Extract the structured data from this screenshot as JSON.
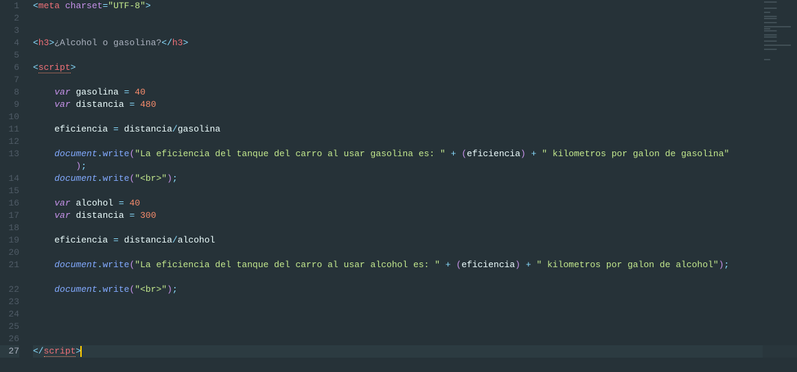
{
  "lines": [
    {
      "num": 1,
      "indent": 0,
      "tokens": [
        [
          "punct",
          "<"
        ],
        [
          "tag",
          "meta"
        ],
        [
          "text",
          " "
        ],
        [
          "attr",
          "charset"
        ],
        [
          "op",
          "="
        ],
        [
          "string",
          "\"UTF-8\""
        ],
        [
          "punct",
          ">"
        ]
      ]
    },
    {
      "num": 2,
      "indent": 0,
      "tokens": []
    },
    {
      "num": 3,
      "indent": 0,
      "tokens": []
    },
    {
      "num": 4,
      "indent": 0,
      "tokens": [
        [
          "punct",
          "<"
        ],
        [
          "tag",
          "h3"
        ],
        [
          "punct",
          ">"
        ],
        [
          "text",
          "¿Alcohol o gasolina?"
        ],
        [
          "punct",
          "</"
        ],
        [
          "tag",
          "h3"
        ],
        [
          "punct",
          ">"
        ]
      ]
    },
    {
      "num": 5,
      "indent": 0,
      "tokens": []
    },
    {
      "num": 6,
      "indent": 0,
      "tokens": [
        [
          "punct",
          "<"
        ],
        [
          "tag-sq",
          "script"
        ],
        [
          "punct",
          ">"
        ]
      ]
    },
    {
      "num": 7,
      "indent": 1,
      "tokens": []
    },
    {
      "num": 8,
      "indent": 1,
      "tokens": [
        [
          "keyword",
          "var"
        ],
        [
          "text",
          " "
        ],
        [
          "var",
          "gasolina"
        ],
        [
          "text",
          " "
        ],
        [
          "op",
          "="
        ],
        [
          "text",
          " "
        ],
        [
          "num",
          "40"
        ]
      ]
    },
    {
      "num": 9,
      "indent": 1,
      "tokens": [
        [
          "keyword",
          "var"
        ],
        [
          "text",
          " "
        ],
        [
          "var",
          "distancia"
        ],
        [
          "text",
          " "
        ],
        [
          "op",
          "="
        ],
        [
          "text",
          " "
        ],
        [
          "num",
          "480"
        ]
      ]
    },
    {
      "num": 10,
      "indent": 1,
      "tokens": []
    },
    {
      "num": 11,
      "indent": 1,
      "tokens": [
        [
          "var",
          "eficiencia"
        ],
        [
          "text",
          " "
        ],
        [
          "op",
          "="
        ],
        [
          "text",
          " "
        ],
        [
          "var",
          "distancia"
        ],
        [
          "op",
          "/"
        ],
        [
          "var",
          "gasolina"
        ]
      ]
    },
    {
      "num": 12,
      "indent": 1,
      "tokens": []
    },
    {
      "num": 13,
      "indent": 1,
      "wrap": true,
      "tokens": [
        [
          "obj",
          "document"
        ],
        [
          "op",
          "."
        ],
        [
          "func",
          "write"
        ],
        [
          "paren",
          "("
        ],
        [
          "string",
          "\"La eficiencia del tanque del carro al usar gasolina es: \""
        ],
        [
          "text",
          " "
        ],
        [
          "op",
          "+"
        ],
        [
          "text",
          " "
        ],
        [
          "paren",
          "("
        ],
        [
          "var",
          "eficiencia"
        ],
        [
          "paren",
          ")"
        ],
        [
          "text",
          " "
        ],
        [
          "op",
          "+"
        ],
        [
          "text",
          " "
        ],
        [
          "string",
          "\" kilometros por galon de gasolina\""
        ]
      ]
    },
    {
      "num": "13b",
      "indent": 2,
      "isWrapCont": true,
      "tokens": [
        [
          "paren",
          ")"
        ],
        [
          "punct",
          ";"
        ]
      ]
    },
    {
      "num": 14,
      "indent": 1,
      "tokens": [
        [
          "obj",
          "document"
        ],
        [
          "op",
          "."
        ],
        [
          "func",
          "write"
        ],
        [
          "paren",
          "("
        ],
        [
          "string",
          "\"<br>\""
        ],
        [
          "paren",
          ")"
        ],
        [
          "punct",
          ";"
        ]
      ]
    },
    {
      "num": 15,
      "indent": 1,
      "tokens": []
    },
    {
      "num": 16,
      "indent": 1,
      "tokens": [
        [
          "keyword",
          "var"
        ],
        [
          "text",
          " "
        ],
        [
          "var",
          "alcohol"
        ],
        [
          "text",
          " "
        ],
        [
          "op",
          "="
        ],
        [
          "text",
          " "
        ],
        [
          "num",
          "40"
        ]
      ]
    },
    {
      "num": 17,
      "indent": 1,
      "tokens": [
        [
          "keyword",
          "var"
        ],
        [
          "text",
          " "
        ],
        [
          "var",
          "distancia"
        ],
        [
          "text",
          " "
        ],
        [
          "op",
          "="
        ],
        [
          "text",
          " "
        ],
        [
          "num",
          "300"
        ]
      ]
    },
    {
      "num": 18,
      "indent": 1,
      "tokens": []
    },
    {
      "num": 19,
      "indent": 1,
      "tokens": [
        [
          "var",
          "eficiencia"
        ],
        [
          "text",
          " "
        ],
        [
          "op",
          "="
        ],
        [
          "text",
          " "
        ],
        [
          "var",
          "distancia"
        ],
        [
          "op",
          "/"
        ],
        [
          "var",
          "alcohol"
        ]
      ]
    },
    {
      "num": 20,
      "indent": 1,
      "tokens": []
    },
    {
      "num": 21,
      "indent": 1,
      "tokens": [
        [
          "obj",
          "document"
        ],
        [
          "op",
          "."
        ],
        [
          "func",
          "write"
        ],
        [
          "paren",
          "("
        ],
        [
          "string",
          "\"La eficiencia del tanque del carro al usar alcohol es: \""
        ],
        [
          "text",
          " "
        ],
        [
          "op",
          "+"
        ],
        [
          "text",
          " "
        ],
        [
          "paren",
          "("
        ],
        [
          "var",
          "eficiencia"
        ],
        [
          "paren",
          ")"
        ],
        [
          "text",
          " "
        ],
        [
          "op",
          "+"
        ],
        [
          "text",
          " "
        ],
        [
          "string",
          "\" kilometros por galon de alcohol\""
        ],
        [
          "paren",
          ")"
        ],
        [
          "punct",
          ";"
        ]
      ]
    },
    {
      "num": "21b",
      "indent": 0,
      "isWrapCont": true,
      "tokens": []
    },
    {
      "num": 22,
      "indent": 1,
      "tokens": [
        [
          "obj",
          "document"
        ],
        [
          "op",
          "."
        ],
        [
          "func",
          "write"
        ],
        [
          "paren",
          "("
        ],
        [
          "string",
          "\"<br>\""
        ],
        [
          "paren",
          ")"
        ],
        [
          "punct",
          ";"
        ]
      ]
    },
    {
      "num": 23,
      "indent": 1,
      "tokens": []
    },
    {
      "num": 24,
      "indent": 1,
      "tokens": []
    },
    {
      "num": 25,
      "indent": 1,
      "tokens": []
    },
    {
      "num": 26,
      "indent": 1,
      "tokens": []
    },
    {
      "num": 27,
      "indent": 0,
      "highlight": true,
      "cursor": true,
      "tokens": [
        [
          "punct",
          "</"
        ],
        [
          "tag-sq",
          "script"
        ],
        [
          "punct",
          ">"
        ]
      ]
    }
  ],
  "minimapLines": [
    "med",
    "empty",
    "empty",
    "med",
    "empty",
    "short",
    "empty",
    "med",
    "med",
    "empty",
    "med",
    "empty",
    "long",
    "short",
    "med",
    "empty",
    "med",
    "med",
    "empty",
    "med",
    "empty",
    "long",
    "empty",
    "med",
    "empty",
    "empty",
    "empty",
    "empty",
    "short"
  ]
}
